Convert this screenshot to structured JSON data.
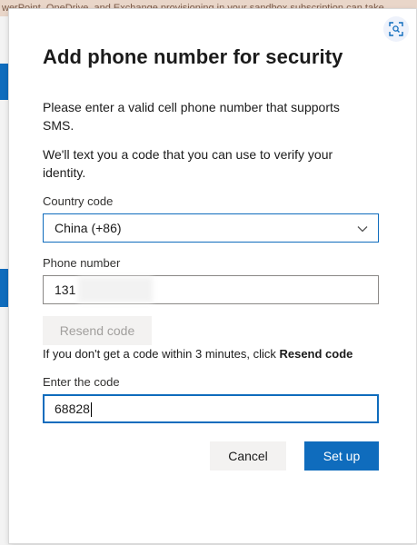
{
  "background": {
    "banner_text": "werPoint, OneDrive, and Exchange provisioning in your sandbox subscription can take"
  },
  "dialog": {
    "title": "Add phone number for security",
    "intro_text": "Please enter a valid cell phone number that supports SMS.",
    "verify_text": "We'll text you a code that you can use to verify your identity.",
    "country_code": {
      "label": "Country code",
      "selected": "China (+86)"
    },
    "phone_number": {
      "label": "Phone number",
      "value": "131"
    },
    "resend_button": "Resend code",
    "hint": {
      "prefix": "If you don't get a code within 3 minutes, click",
      "link": "Resend code"
    },
    "code": {
      "label": "Enter the code",
      "value": "68828"
    },
    "buttons": {
      "cancel": "Cancel",
      "setup": "Set up"
    }
  },
  "colors": {
    "accent": "#0f6cbd",
    "disabled_bg": "#f3f2f1",
    "disabled_text": "#a19f9d"
  },
  "icons": {
    "corner": "expand-capture-icon",
    "dropdown": "chevron-down-icon"
  }
}
